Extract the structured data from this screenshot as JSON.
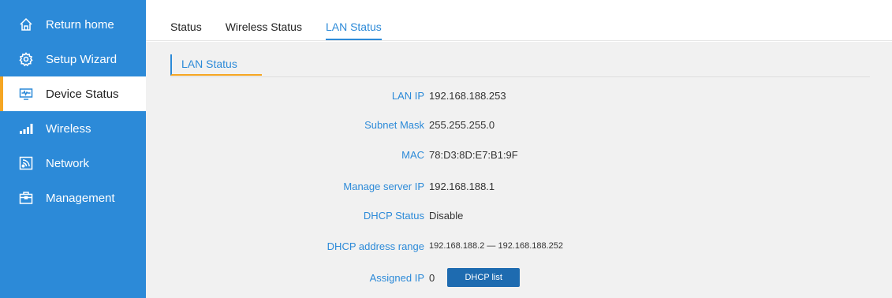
{
  "sidebar": {
    "items": [
      {
        "label": "Return home",
        "icon": "home-icon",
        "active": false
      },
      {
        "label": "Setup Wizard",
        "icon": "gear-icon",
        "active": false
      },
      {
        "label": "Device Status",
        "icon": "monitor-icon",
        "active": true
      },
      {
        "label": "Wireless",
        "icon": "signal-icon",
        "active": false
      },
      {
        "label": "Network",
        "icon": "network-icon",
        "active": false
      },
      {
        "label": "Management",
        "icon": "briefcase-icon",
        "active": false
      }
    ],
    "bg_color": "#2c8ad8",
    "active_accent": "#f5a623"
  },
  "tabs": [
    {
      "label": "Status",
      "active": false
    },
    {
      "label": "Wireless Status",
      "active": false
    },
    {
      "label": "LAN Status",
      "active": true
    }
  ],
  "section": {
    "title": "LAN Status"
  },
  "lan": {
    "lan_ip_label": "LAN IP",
    "lan_ip": "192.168.188.253",
    "subnet_label": "Subnet Mask",
    "subnet": "255.255.255.0",
    "mac_label": "MAC",
    "mac": "78:D3:8D:E7:B1:9F",
    "manage_ip_label": "Manage server IP",
    "manage_ip": "192.168.188.1",
    "dhcp_status_label": "DHCP Status",
    "dhcp_status": "Disable",
    "dhcp_range_label": "DHCP address range",
    "dhcp_range": "192.168.188.2 — 192.168.188.252",
    "assigned_label": "Assigned IP",
    "assigned": "0",
    "dhcp_list_button": "DHCP list"
  }
}
